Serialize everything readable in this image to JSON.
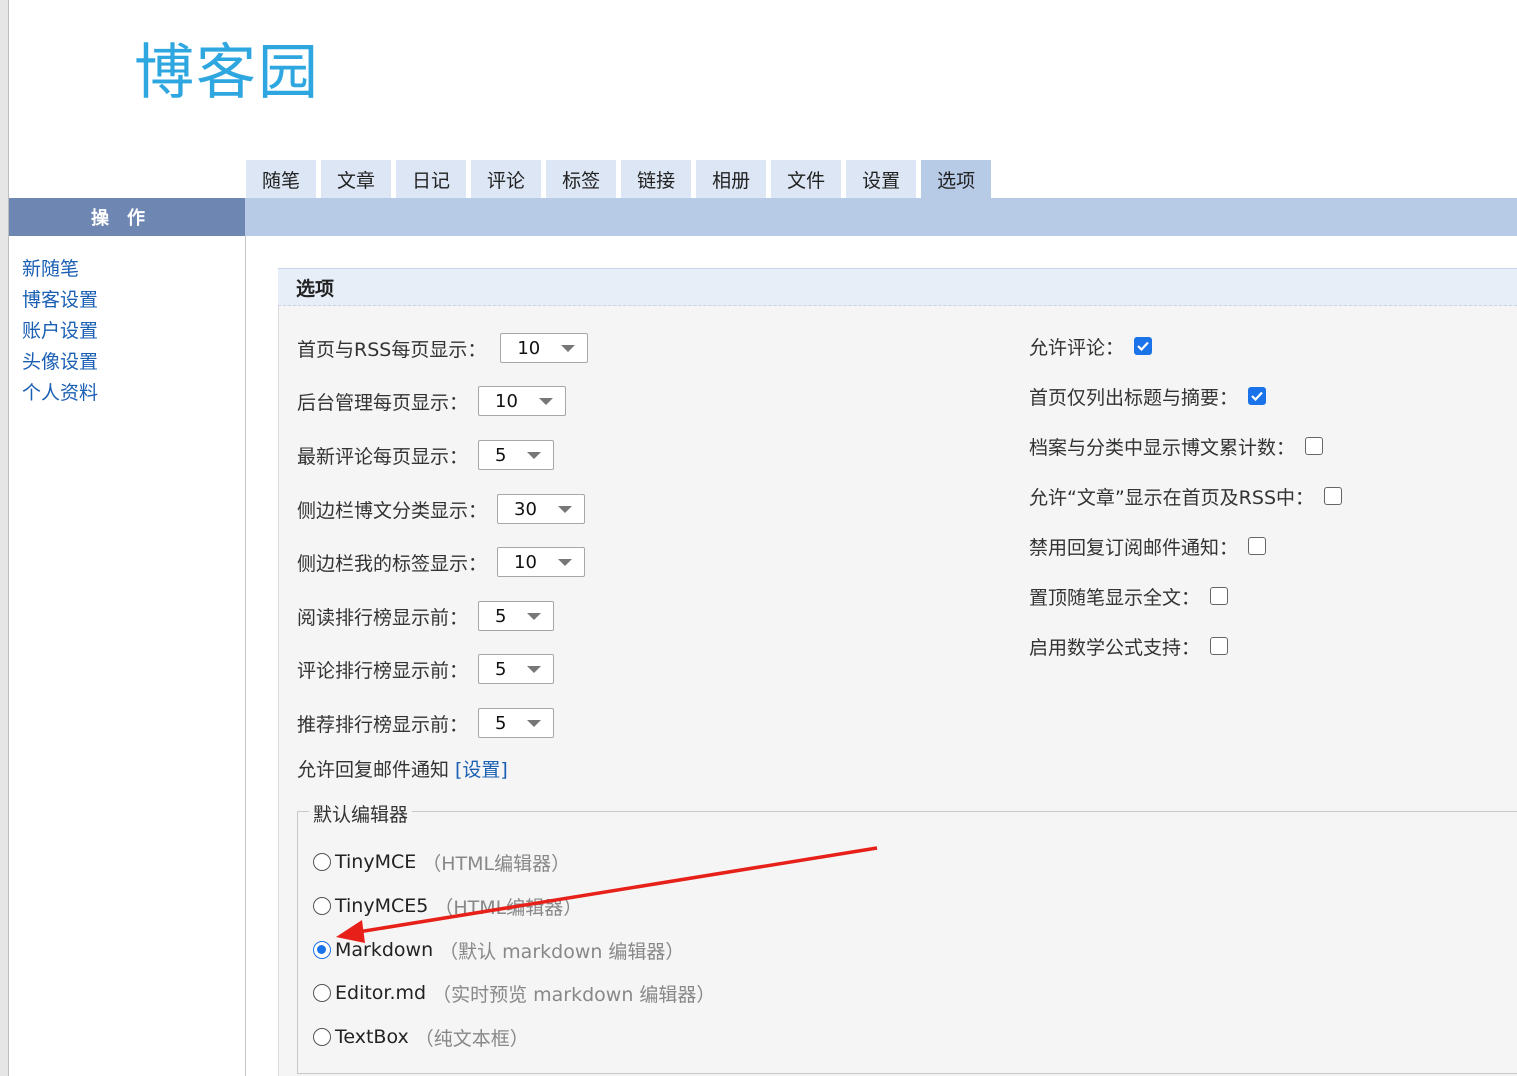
{
  "logo": {
    "text": "博客园"
  },
  "tabs": [
    {
      "label": "随笔"
    },
    {
      "label": "文章"
    },
    {
      "label": "日记"
    },
    {
      "label": "评论"
    },
    {
      "label": "标签"
    },
    {
      "label": "链接"
    },
    {
      "label": "相册"
    },
    {
      "label": "文件"
    },
    {
      "label": "设置"
    },
    {
      "label": "选项"
    }
  ],
  "sidebar": {
    "header": "操作",
    "links": [
      {
        "label": "新随笔"
      },
      {
        "label": "博客设置"
      },
      {
        "label": "账户设置"
      },
      {
        "label": "头像设置"
      },
      {
        "label": "个人资料"
      }
    ]
  },
  "panel": {
    "title": "选项",
    "selects": [
      {
        "label": "首页与RSS每页显示：",
        "value": "10"
      },
      {
        "label": "后台管理每页显示：",
        "value": "10"
      },
      {
        "label": "最新评论每页显示：",
        "value": "5"
      },
      {
        "label": "侧边栏博文分类显示：",
        "value": "30"
      },
      {
        "label": "侧边栏我的标签显示：",
        "value": "10"
      },
      {
        "label": "阅读排行榜显示前：",
        "value": "5"
      },
      {
        "label": "评论排行榜显示前：",
        "value": "5"
      },
      {
        "label": "推荐排行榜显示前：",
        "value": "5"
      }
    ],
    "reply_notice": {
      "label": "允许回复邮件通知",
      "link": "[设置]"
    },
    "checkboxes": [
      {
        "label": "允许评论：",
        "checked": true
      },
      {
        "label": "首页仅列出标题与摘要：",
        "checked": true
      },
      {
        "label": "档案与分类中显示博文累计数：",
        "checked": false
      },
      {
        "label": "允许“文章”显示在首页及RSS中：",
        "checked": false
      },
      {
        "label": "禁用回复订阅邮件通知：",
        "checked": false
      },
      {
        "label": "置顶随笔显示全文：",
        "checked": false
      },
      {
        "label": "启用数学公式支持：",
        "checked": false
      }
    ],
    "editor": {
      "legend": "默认编辑器",
      "options": [
        {
          "name": "TinyMCE",
          "desc": "（HTML编辑器）",
          "selected": false
        },
        {
          "name": "TinyMCE5",
          "desc": "（HTML编辑器）",
          "selected": false
        },
        {
          "name": "Markdown",
          "desc": "（默认 markdown 编辑器）",
          "selected": true
        },
        {
          "name": "Editor.md",
          "desc": "（实时预览 markdown 编辑器）",
          "selected": false
        },
        {
          "name": "TextBox",
          "desc": "（纯文本框）",
          "selected": false
        }
      ]
    }
  },
  "colors": {
    "accent": "#1a73e8",
    "tab": "#dce6f4",
    "tab_active": "#b7cbe7",
    "sidebar_header": "#6e86b2",
    "annotation": "#e8201a"
  }
}
